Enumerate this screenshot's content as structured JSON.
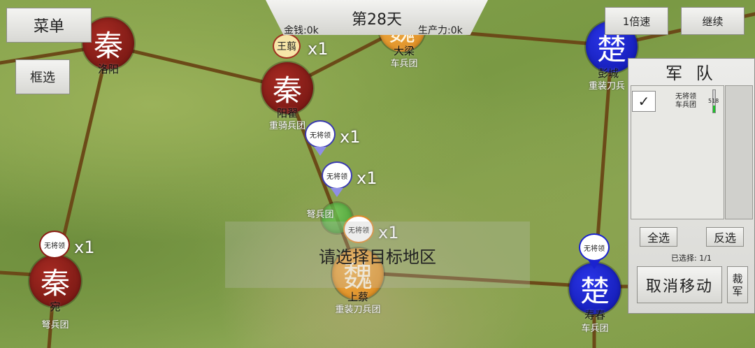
{
  "header": {
    "day": "第28天",
    "money": "金钱:0k",
    "production": "生产力:0k"
  },
  "buttons": {
    "menu": "菜单",
    "box_select": "框选",
    "speed": "1倍速",
    "continue": "继续",
    "select_all": "全选",
    "invert_select": "反选",
    "cancel_move": "取消移动",
    "disband": "裁\n军"
  },
  "army_panel": {
    "title": "军 队",
    "check_mark": "✓",
    "entry_label": "无将领\n车兵团",
    "hp_text": "518",
    "hp_fraction": 0.3,
    "selected": "已选择:  1/1"
  },
  "hint": "请选择目标地区",
  "cities": [
    {
      "id": "luoyang",
      "glyph": "秦",
      "faction": "qin",
      "name": "洛阳",
      "unit": ""
    },
    {
      "id": "yangzhai",
      "glyph": "秦",
      "faction": "qin",
      "name": "阳翟",
      "unit": "重骑兵团"
    },
    {
      "id": "daliang",
      "glyph": "魏",
      "faction": "wei",
      "name": "大梁",
      "unit": "车兵团"
    },
    {
      "id": "pengcheng",
      "glyph": "楚",
      "faction": "chu",
      "name": "彭城",
      "unit": "重装刀兵"
    },
    {
      "id": "wan",
      "glyph": "秦",
      "faction": "qin",
      "name": "宛",
      "unit": "弩兵团"
    },
    {
      "id": "shangcai",
      "glyph": "魏",
      "faction": "wei",
      "name": "上蔡",
      "unit": "重装刀兵团"
    },
    {
      "id": "shouchun",
      "glyph": "楚",
      "faction": "chu",
      "name": "寿春",
      "unit": "车兵团"
    },
    {
      "id": "nujun",
      "glyph": "",
      "faction": "zhao",
      "name": "",
      "unit": "弩兵团"
    }
  ],
  "armies": [
    {
      "id": "wangjian",
      "label": "王翦",
      "count": "x1"
    },
    {
      "id": "army1",
      "label": "无将领",
      "count": "x1"
    },
    {
      "id": "army2",
      "label": "无将领",
      "count": "x1"
    },
    {
      "id": "army3",
      "label": "无将领",
      "count": "x1"
    },
    {
      "id": "army4",
      "label": "无将领",
      "count": "x1"
    },
    {
      "id": "army5",
      "label": "无将领",
      "count": "x1"
    }
  ],
  "colors": {
    "qin": "#8b1c15",
    "chu": "#1a22d0",
    "wei": "#eb9c30",
    "road": "#6b4a18"
  }
}
